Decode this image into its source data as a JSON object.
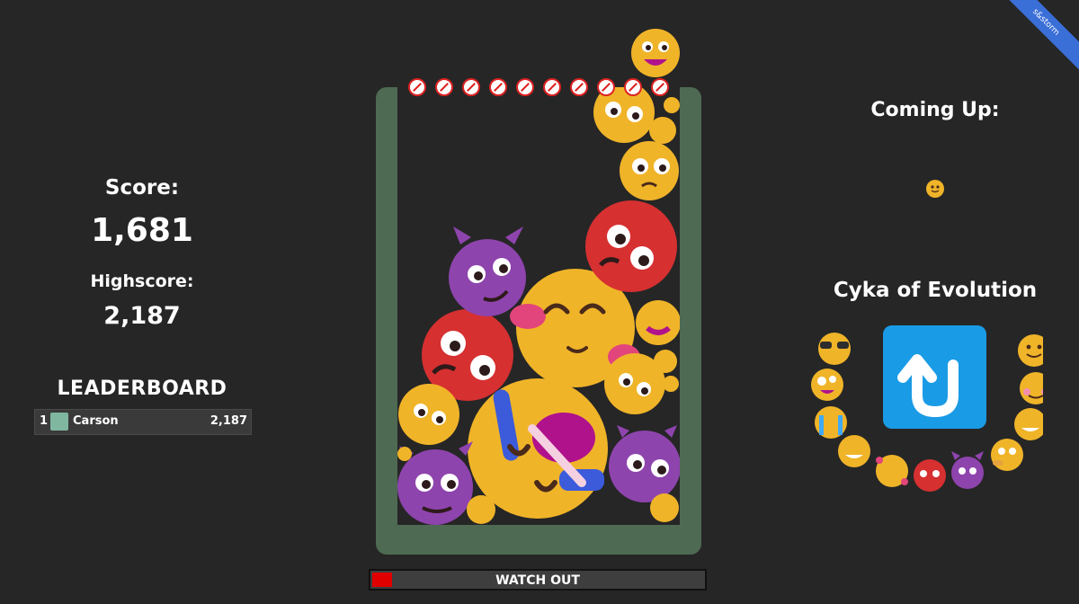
{
  "stats": {
    "score_label": "Score:",
    "score_value": "1,681",
    "highscore_label": "Highscore:",
    "highscore_value": "2,187"
  },
  "leaderboard": {
    "title": "LEADERBOARD",
    "rows": [
      {
        "rank": "1",
        "name": "Carson",
        "score": "2,187"
      }
    ]
  },
  "next": {
    "label": "Coming Up:",
    "emoji": "slightly-smiling-face"
  },
  "cycle": {
    "title": "Cyka of Evolution",
    "center_icon": "up-arrow-u-turn-icon",
    "emojis": [
      "sunglasses-face",
      "zany-face",
      "crying-face",
      "grinning-sweat-face",
      "smiling-hearts-face",
      "angry-face",
      "smiling-devil-face",
      "thinking-face",
      "grinning-face",
      "blushing-face",
      "smiling-face"
    ]
  },
  "warning": {
    "text": "WATCH OUT",
    "level": 0.06
  },
  "watermark": {
    "text": "s&storm"
  },
  "colors": {
    "background": "#262626",
    "container": "#4e6a52",
    "yellow": "#f0b429",
    "red": "#d63031",
    "purple": "#8e44ad",
    "warning_fill": "#e00000",
    "cycle_box": "#1a9be6"
  }
}
